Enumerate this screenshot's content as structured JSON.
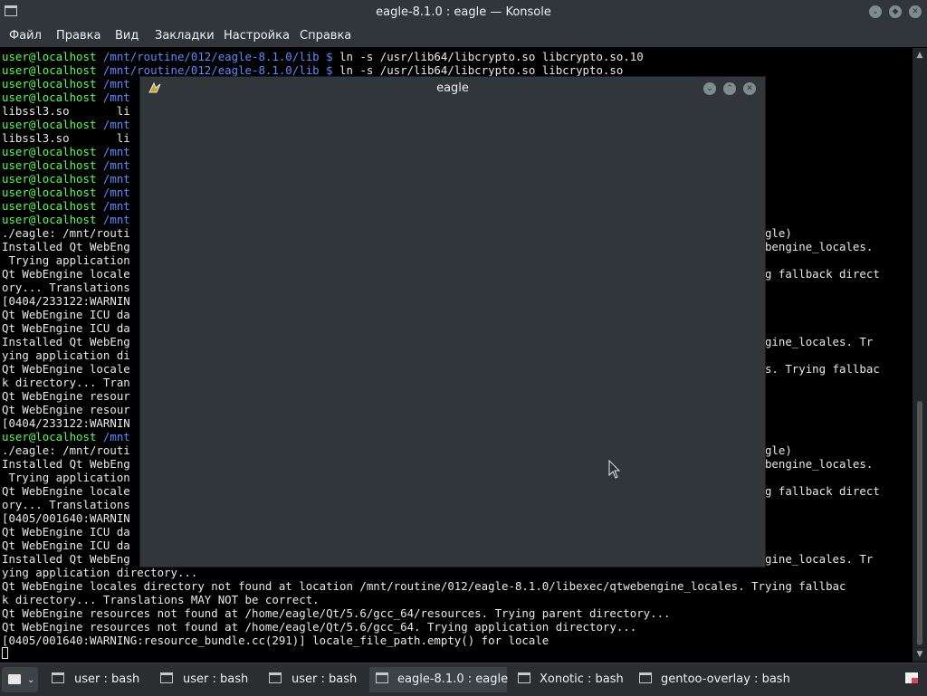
{
  "window": {
    "title": "eagle-8.1.0 : eagle — Konsole"
  },
  "menu": [
    "Файл",
    "Правка",
    "Вид",
    "Закладки",
    "Настройка",
    "Справка"
  ],
  "terminal": {
    "lines": [
      {
        "user": "user@localhost",
        "path": " /mnt/routine/012/eagle-8.1.0/lib $",
        "text": " ln -s /usr/lib64/libcrypto.so libcrypto.so.10"
      },
      {
        "user": "user@localhost",
        "path": " /mnt/routine/012/eagle-8.1.0/lib $",
        "text": " ln -s /usr/lib64/libcrypto.so libcrypto.so"
      },
      {
        "user": "user@localhost",
        "path": " /mnt",
        "text": ""
      },
      {
        "user": "user@localhost",
        "path": " /mnt",
        "text": ""
      },
      {
        "user": "",
        "path": "",
        "text": "libssl3.so       li"
      },
      {
        "user": "user@localhost",
        "path": " /mnt",
        "text": ""
      },
      {
        "user": "",
        "path": "",
        "text": "libssl3.so       li"
      },
      {
        "user": "user@localhost",
        "path": " /mnt",
        "text": ""
      },
      {
        "user": "user@localhost",
        "path": " /mnt",
        "text": ""
      },
      {
        "user": "user@localhost",
        "path": " /mnt",
        "text": ""
      },
      {
        "user": "user@localhost",
        "path": " /mnt",
        "text": ""
      },
      {
        "user": "user@localhost",
        "path": " /mnt",
        "text": ""
      },
      {
        "user": "user@localhost",
        "path": " /mnt",
        "text": ""
      },
      {
        "user": "",
        "path": "",
        "text": "./eagle: /mnt/routi                                                                                           /eagle)"
      },
      {
        "user": "",
        "path": "",
        "text": "Installed Qt WebEng                                                                                          qtwebengine_locales."
      },
      {
        "user": "",
        "path": "",
        "text": " Trying application"
      },
      {
        "user": "",
        "path": "",
        "text": "Qt WebEngine locale                                                                                           ying fallback direct"
      },
      {
        "user": "",
        "path": "",
        "text": "ory... Translations"
      },
      {
        "user": "",
        "path": "",
        "text": "[0404/233122:WARNIN"
      },
      {
        "user": "",
        "path": "",
        "text": "Qt WebEngine ICU da"
      },
      {
        "user": "",
        "path": "",
        "text": "Qt WebEngine ICU da"
      },
      {
        "user": "",
        "path": "",
        "text": "Installed Qt WebEng                                                                                          ebengine_locales. Tr"
      },
      {
        "user": "",
        "path": "",
        "text": "ying application di"
      },
      {
        "user": "",
        "path": "",
        "text": "Qt WebEngine locale                                                                                           ales. Trying fallbac"
      },
      {
        "user": "",
        "path": "",
        "text": "k directory... Tran"
      },
      {
        "user": "",
        "path": "",
        "text": "Qt WebEngine resour"
      },
      {
        "user": "",
        "path": "",
        "text": "Qt WebEngine resour"
      },
      {
        "user": "",
        "path": "",
        "text": "[0404/233122:WARNIN"
      },
      {
        "user": "user@localhost",
        "path": " /mnt",
        "text": ""
      },
      {
        "user": "",
        "path": "",
        "text": "./eagle: /mnt/routi                                                                                           /eagle)"
      },
      {
        "user": "",
        "path": "",
        "text": "Installed Qt WebEng                                                                                          qtwebengine_locales."
      },
      {
        "user": "",
        "path": "",
        "text": " Trying application"
      },
      {
        "user": "",
        "path": "",
        "text": "Qt WebEngine locale                                                                                           ying fallback direct"
      },
      {
        "user": "",
        "path": "",
        "text": "ory... Translations"
      },
      {
        "user": "",
        "path": "",
        "text": "[0405/001640:WARNIN"
      },
      {
        "user": "",
        "path": "",
        "text": "Qt WebEngine ICU da"
      },
      {
        "user": "",
        "path": "",
        "text": "Qt WebEngine ICU da"
      },
      {
        "user": "",
        "path": "",
        "text": "Installed Qt WebEng                                                                                          ebengine_locales. Tr"
      },
      {
        "user": "",
        "path": "",
        "text": "ying application directory..."
      },
      {
        "user": "",
        "path": "",
        "text": "Qt WebEngine locales directory not found at location /mnt/routine/012/eagle-8.1.0/libexec/qtwebengine_locales. Trying fallbac"
      },
      {
        "user": "",
        "path": "",
        "text": "k directory... Translations MAY NOT be correct."
      },
      {
        "user": "",
        "path": "",
        "text": "Qt WebEngine resources not found at /home/eagle/Qt/5.6/gcc_64/resources. Trying parent directory..."
      },
      {
        "user": "",
        "path": "",
        "text": "Qt WebEngine resources not found at /home/eagle/Qt/5.6/gcc_64. Trying application directory..."
      },
      {
        "user": "",
        "path": "",
        "text": "[0405/001640:WARNING:resource_bundle.cc(291)] locale_file_path.empty() for locale"
      }
    ]
  },
  "eagle_window": {
    "title": "eagle"
  },
  "taskbar": {
    "tasks": [
      {
        "label": "user : bash",
        "active": false
      },
      {
        "label": "user : bash",
        "active": false
      },
      {
        "label": "user : bash",
        "active": false
      },
      {
        "label": "eagle-8.1.0 : eagle",
        "active": true
      },
      {
        "label": "Xonotic : bash",
        "active": false
      },
      {
        "label": "gentoo-overlay : bash",
        "active": false
      }
    ]
  },
  "colors": {
    "prompt_user": "#54ff54",
    "prompt_path": "#5c8cff",
    "panel_bg": "#31363b",
    "text": "#e8e8e8"
  }
}
